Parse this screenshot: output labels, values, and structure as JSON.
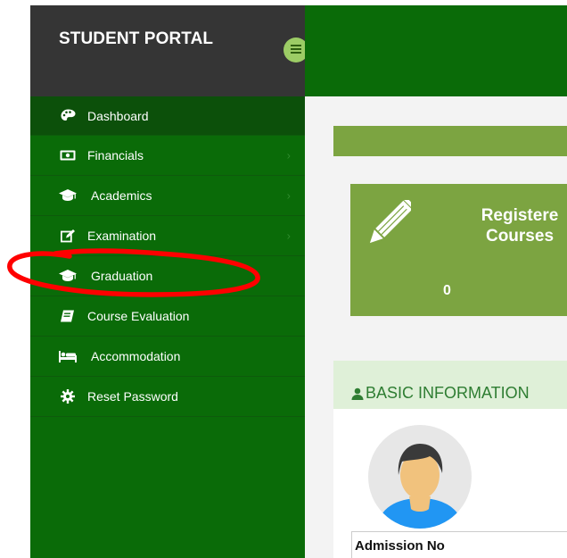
{
  "sidebar": {
    "brand": "STUDENT PORTAL",
    "toggle_icon": "hamburger-icon",
    "items": [
      {
        "label": "Dashboard",
        "icon": "palette-icon",
        "has_submenu": false
      },
      {
        "label": "Financials",
        "icon": "money-bill-icon",
        "has_submenu": true
      },
      {
        "label": "Academics",
        "icon": "graduation-cap-icon",
        "has_submenu": true
      },
      {
        "label": "Examination",
        "icon": "edit-icon",
        "has_submenu": true
      },
      {
        "label": "Graduation",
        "icon": "graduation-cap-icon",
        "has_submenu": false
      },
      {
        "label": "Course Evaluation",
        "icon": "book-icon",
        "has_submenu": false
      },
      {
        "label": "Accommodation",
        "icon": "bed-icon",
        "has_submenu": false
      },
      {
        "label": "Reset Password",
        "icon": "cog-icon",
        "has_submenu": false
      }
    ]
  },
  "main": {
    "card": {
      "title_line1": "Registere",
      "title_line2": "Courses",
      "count": "0",
      "icon": "pencil-icon"
    },
    "basic_info": {
      "title": "BASIC INFORMATION",
      "icon": "user-icon"
    },
    "profile": {
      "avatar_icon": "avatar-icon",
      "admission_label": "Admission No"
    }
  },
  "colors": {
    "sidebar_green": "#0a6b08",
    "brand_dark": "#353535",
    "olive": "#7ca441",
    "toggle": "#9ccc65",
    "annotation_red": "#ff0000"
  }
}
